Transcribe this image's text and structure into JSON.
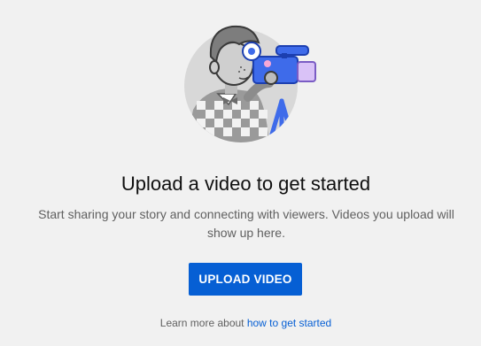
{
  "empty_state": {
    "illustration": "videographer-with-camera-illustration",
    "title": "Upload a video to get started",
    "subtitle": "Start sharing your story and connecting with viewers. Videos you upload will show up here.",
    "upload_button_label": "UPLOAD VIDEO",
    "learn_more_prefix": "Learn more about ",
    "learn_more_link": "how to get started"
  },
  "colors": {
    "background": "#f1f1f1",
    "accent": "#065fd4",
    "camera_blue": "#3e6bea",
    "camera_lilac": "#d9c2f7"
  }
}
